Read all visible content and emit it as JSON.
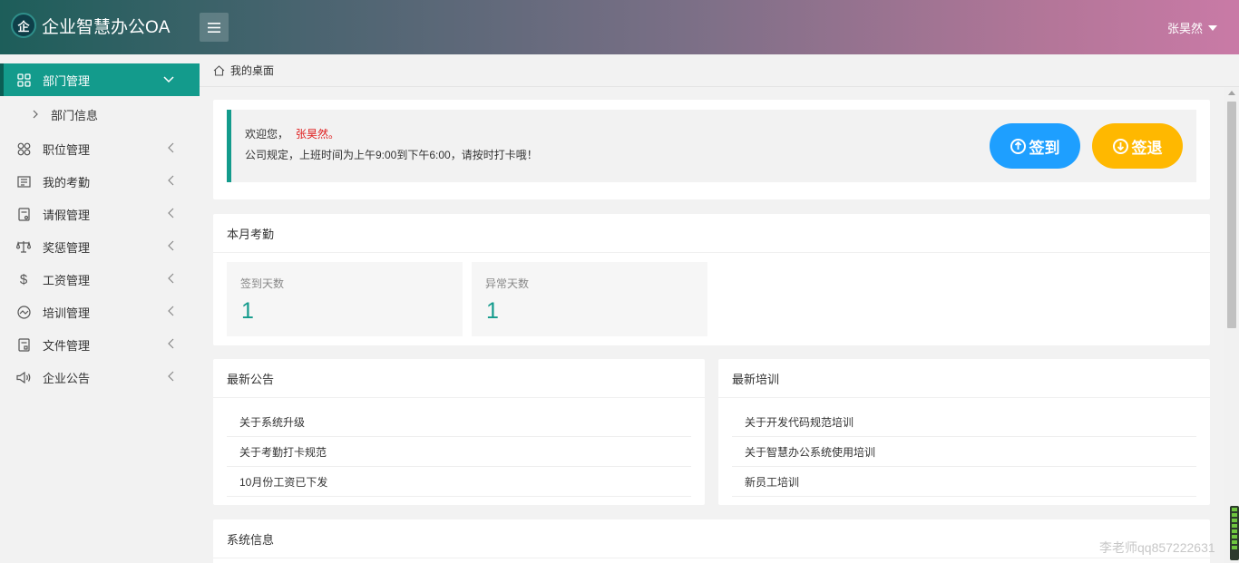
{
  "app": {
    "title": "企业智慧办公OA",
    "logo_char": "企"
  },
  "header": {
    "username": "张昊然"
  },
  "sidebar": {
    "items": [
      {
        "label": "部门管理",
        "icon": "grid-icon",
        "expanded": true
      },
      {
        "label": "职位管理",
        "icon": "apps-icon"
      },
      {
        "label": "我的考勤",
        "icon": "calendar-icon"
      },
      {
        "label": "请假管理",
        "icon": "form-icon"
      },
      {
        "label": "奖惩管理",
        "icon": "scale-icon"
      },
      {
        "label": "工资管理",
        "icon": "dollar-icon"
      },
      {
        "label": "培训管理",
        "icon": "chart-icon"
      },
      {
        "label": "文件管理",
        "icon": "file-icon"
      },
      {
        "label": "企业公告",
        "icon": "speaker-icon"
      }
    ],
    "sub_items": [
      {
        "label": "部门信息"
      }
    ]
  },
  "breadcrumb": {
    "label": "我的桌面"
  },
  "welcome": {
    "greeting": "欢迎您，",
    "name": "张昊然。",
    "notice": "公司规定，上班时间为上午9:00到下午6:00，请按时打卡哦！",
    "checkin_label": "签到",
    "checkout_label": "签退",
    "checkin_color": "#1e9fff",
    "checkout_color": "#ffb800"
  },
  "attendance": {
    "title": "本月考勤",
    "stats": [
      {
        "label": "签到天数",
        "value": "1"
      },
      {
        "label": "异常天数",
        "value": "1"
      }
    ]
  },
  "notices": {
    "title": "最新公告",
    "items": [
      "关于系统升级",
      "关于考勤打卡规范",
      "10月份工资已下发"
    ]
  },
  "trainings": {
    "title": "最新培训",
    "items": [
      "关于开发代码规范培训",
      "关于智慧办公系统使用培训",
      "新员工培训"
    ]
  },
  "system": {
    "title": "系统信息"
  },
  "watermark": "李老师qq857222631",
  "theme": {
    "accent": "#139b8c",
    "danger": "#e02020"
  }
}
